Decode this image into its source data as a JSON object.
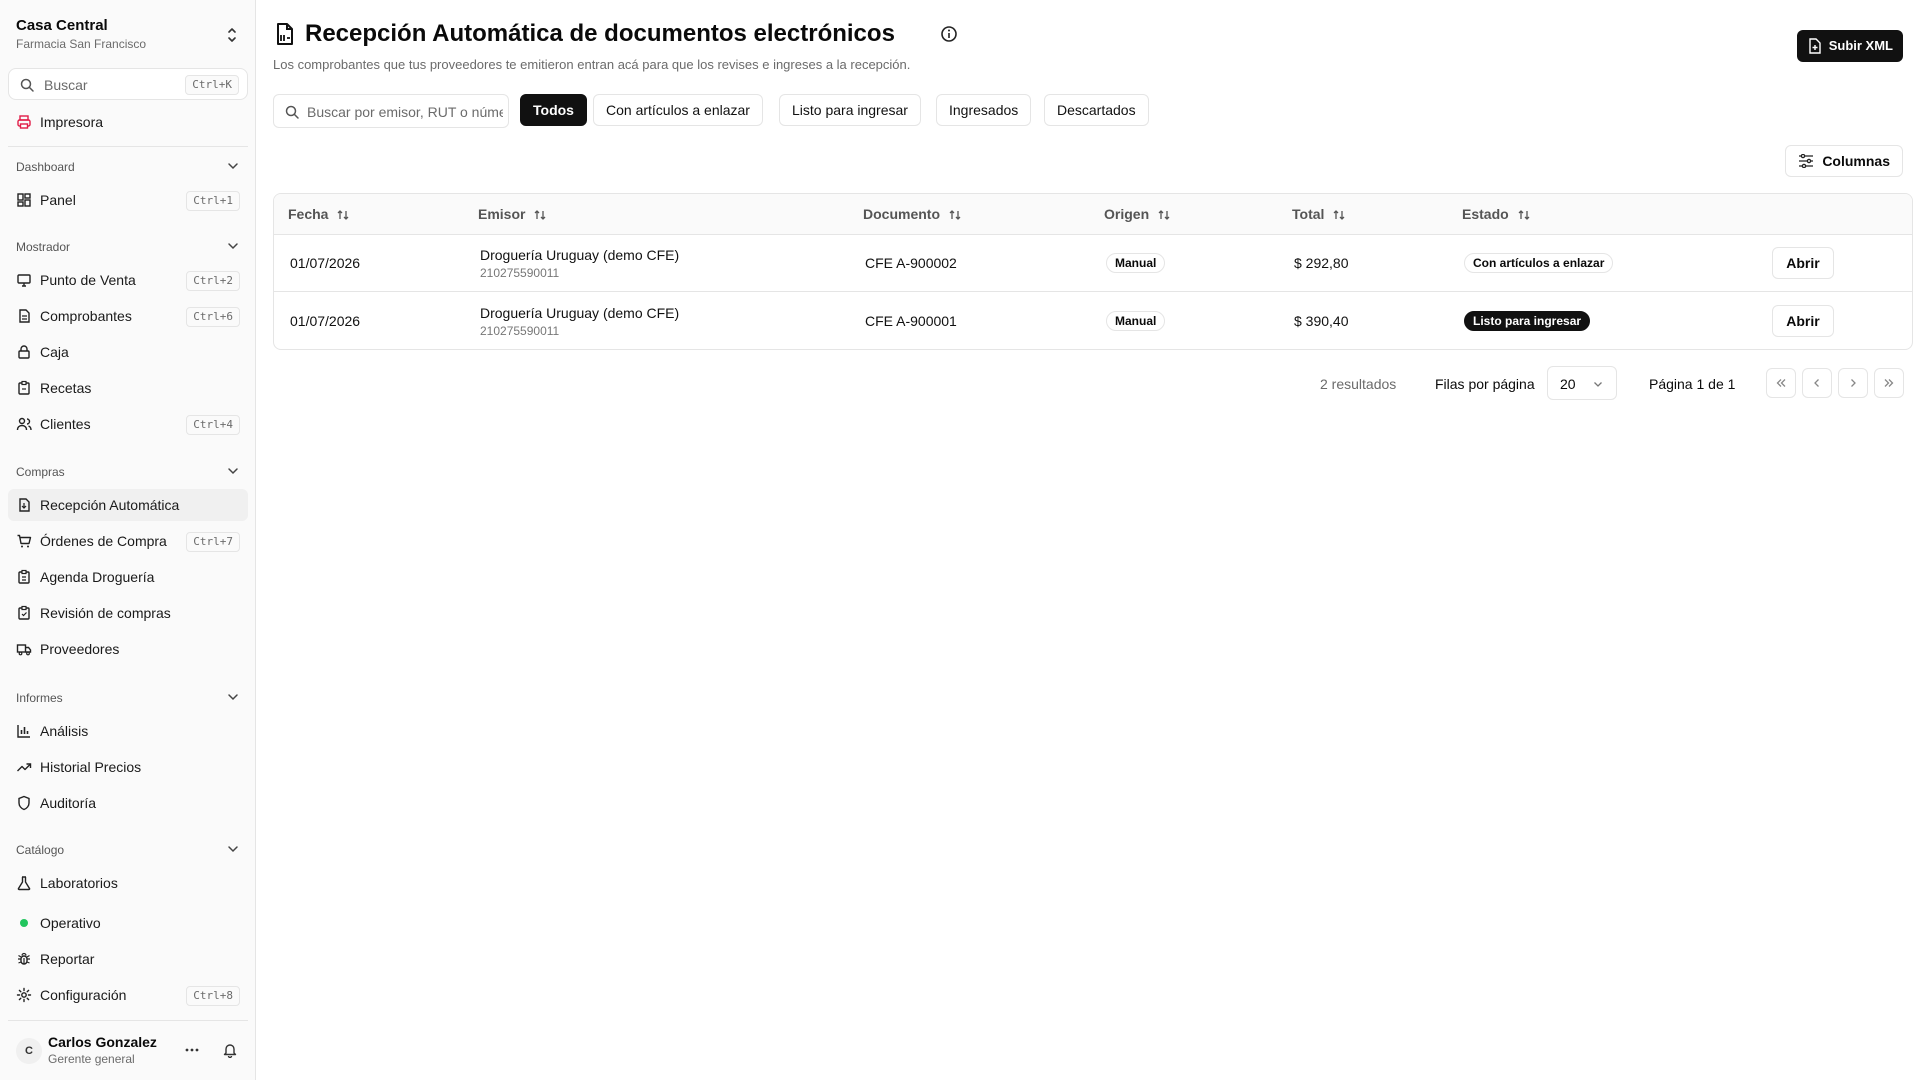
{
  "sidebar": {
    "org_name": "Casa Central",
    "org_sub": "Farmacia San Francisco",
    "search_placeholder": "Buscar",
    "search_kbd": "Ctrl+K",
    "printer": "Impresora",
    "groups": {
      "dashboard": "Dashboard",
      "mostrador": "Mostrador",
      "compras": "Compras",
      "informes": "Informes",
      "catalogo": "Catálogo"
    },
    "items": {
      "panel": {
        "label": "Panel",
        "kbd": "Ctrl+1"
      },
      "pos": {
        "label": "Punto de Venta",
        "kbd": "Ctrl+2"
      },
      "comprobantes": {
        "label": "Comprobantes",
        "kbd": "Ctrl+6"
      },
      "caja": {
        "label": "Caja"
      },
      "recetas": {
        "label": "Recetas"
      },
      "clientes": {
        "label": "Clientes",
        "kbd": "Ctrl+4"
      },
      "recepcion": {
        "label": "Recepción Automática"
      },
      "ordenes": {
        "label": "Órdenes de Compra",
        "kbd": "Ctrl+7"
      },
      "agenda": {
        "label": "Agenda Droguería"
      },
      "revision": {
        "label": "Revisión de compras"
      },
      "proveedores": {
        "label": "Proveedores"
      },
      "analisis": {
        "label": "Análisis"
      },
      "historial": {
        "label": "Historial Precios"
      },
      "auditoria": {
        "label": "Auditoría"
      },
      "laboratorios": {
        "label": "Laboratorios"
      },
      "operativo": {
        "label": "Operativo"
      },
      "reportar": {
        "label": "Reportar"
      },
      "config": {
        "label": "Configuración",
        "kbd": "Ctrl+8"
      }
    },
    "user": {
      "initial": "C",
      "name": "Carlos Gonzalez",
      "role": "Gerente general"
    }
  },
  "header": {
    "title": "Recepción Automática de documentos electrónicos",
    "subtitle": "Los comprobantes que tus proveedores te emitieron entran acá para que los revises e ingreses a la recepción.",
    "upload_label": "Subir XML"
  },
  "filters": {
    "search_placeholder": "Buscar por emisor, RUT o número",
    "chips": [
      "Todos",
      "Con artículos a enlazar",
      "Listo para ingresar",
      "Ingresados",
      "Descartados"
    ]
  },
  "columns_label": "Columnas",
  "table": {
    "headers": [
      "Fecha",
      "Emisor",
      "Documento",
      "Origen",
      "Total",
      "Estado"
    ],
    "rows": [
      {
        "fecha": "01/07/2026",
        "emisor": "Droguería Uruguay (demo CFE)",
        "rut": "210275590011",
        "documento": "CFE A-900002",
        "origen": "Manual",
        "total": "$ 292,80",
        "estado": "Con artículos a enlazar",
        "action": "Abrir"
      },
      {
        "fecha": "01/07/2026",
        "emisor": "Droguería Uruguay (demo CFE)",
        "rut": "210275590011",
        "documento": "CFE A-900001",
        "origen": "Manual",
        "total": "$ 390,40",
        "estado": "Listo para ingresar",
        "action": "Abrir"
      }
    ]
  },
  "pager": {
    "results": "2 resultados",
    "rows_per_page_label": "Filas por página",
    "rows_per_page": "20",
    "page_label": "Página 1 de 1"
  },
  "colors": {
    "accent": "#111111",
    "status_dot": "#22c55e",
    "printer_icon": "#e11d48"
  }
}
